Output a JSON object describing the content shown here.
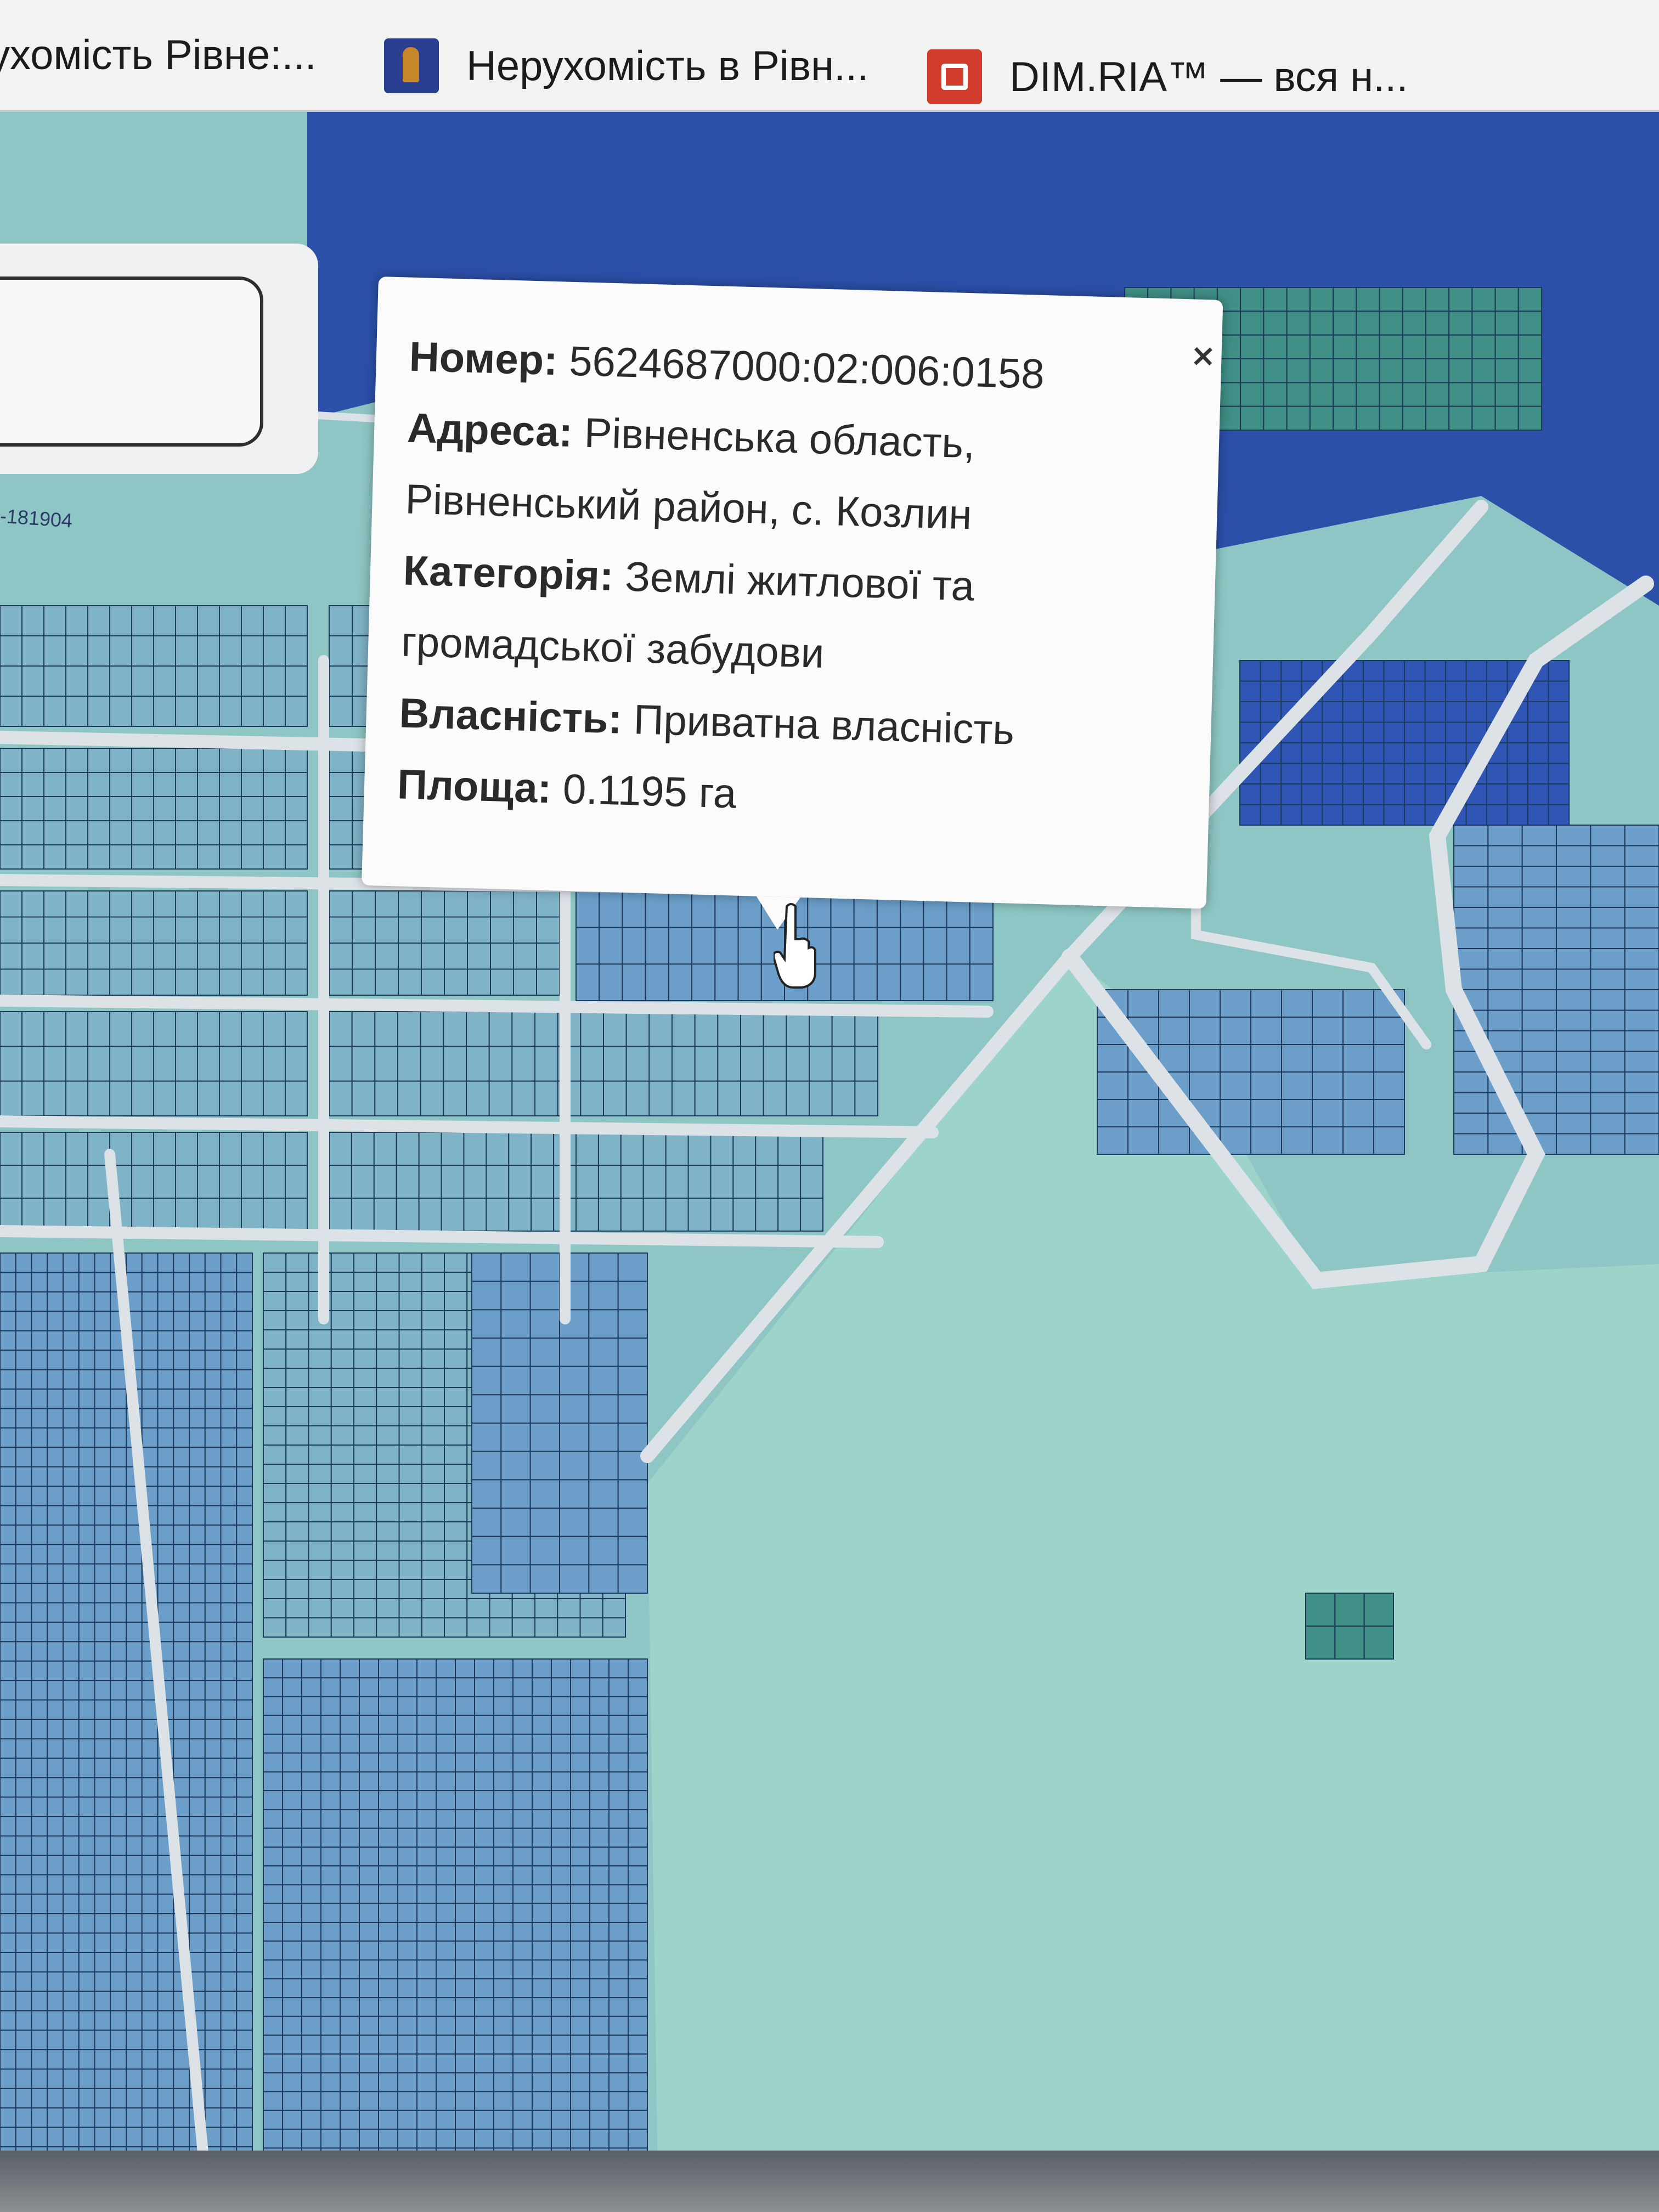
{
  "bookmarks": [
    {
      "label": "ухомість Рівне:...",
      "icon": "none"
    },
    {
      "label": "Нерухомість в Рівн...",
      "icon": "key-icon"
    },
    {
      "label": "DIM.RIA™ — вся н...",
      "icon": "house-logo-icon"
    }
  ],
  "map": {
    "scale_label": "-181904",
    "colors": {
      "parcel_light": "#7fb3c6",
      "parcel_mid": "#6b9fc9",
      "parcel_dark": "#2f55b5",
      "parcel_teal": "#3f8f86",
      "road": "#d9dde3",
      "field": "#8fd0c4",
      "selected": "#c0392b"
    }
  },
  "popup": {
    "number_label": "Номер:",
    "number_value": "5624687000:02:006:0158",
    "address_label": "Адреса:",
    "address_value_1": "Рівненська область,",
    "address_value_2": "Рівненський район, с. Козлин",
    "category_label": "Категорія:",
    "category_value_1": "Землі житлової та",
    "category_value_2": "громадської забудови",
    "ownership_label": "Власність:",
    "ownership_value": "Приватна власність",
    "area_label": "Площа:",
    "area_value": "0.1195 га",
    "close_label": "×"
  }
}
